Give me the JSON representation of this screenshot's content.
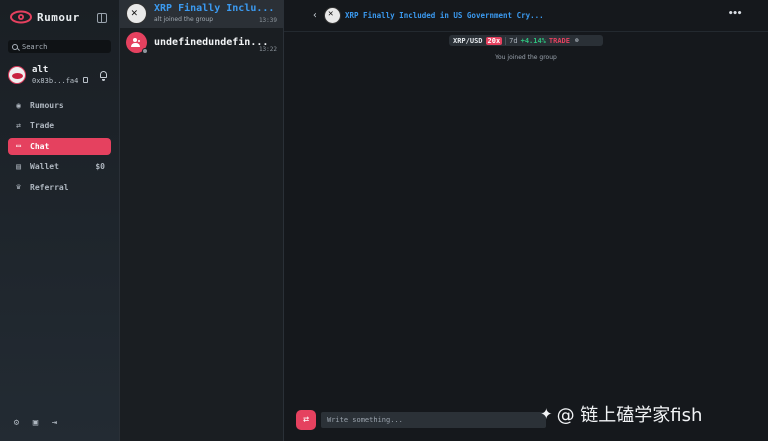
{
  "brand": {
    "name": "Rumour"
  },
  "search": {
    "placeholder": "Search"
  },
  "user": {
    "name": "alt",
    "address": "0x83b...fa4"
  },
  "nav": {
    "items": [
      {
        "label": "Rumours",
        "icon": "eye-icon"
      },
      {
        "label": "Trade",
        "icon": "swap-icon"
      },
      {
        "label": "Chat",
        "icon": "chat-icon",
        "active": true
      },
      {
        "label": "Wallet",
        "icon": "wallet-icon",
        "value": "$0"
      },
      {
        "label": "Referral",
        "icon": "trophy-icon"
      }
    ]
  },
  "chats": [
    {
      "title": "XRP Finally Inclu...",
      "subtitle": "alt joined the group",
      "time": "13:39"
    },
    {
      "title": "undefinedundefin...",
      "subtitle": "",
      "time": "13:22"
    }
  ],
  "conversation": {
    "title": "XRP Finally Included in US Government Cry...",
    "ticker": {
      "pair": "XRP/USD",
      "leverage": "20x",
      "period": "7d",
      "change": "+4.14%",
      "action": "TRADE"
    },
    "system_message": "You joined the group"
  },
  "composer": {
    "placeholder": "Write something..."
  },
  "watermark": {
    "text": "@ 链上磕学家fish"
  },
  "colors": {
    "accent": "#e5415f",
    "link": "#3b9af0",
    "positive": "#2ec27e"
  }
}
